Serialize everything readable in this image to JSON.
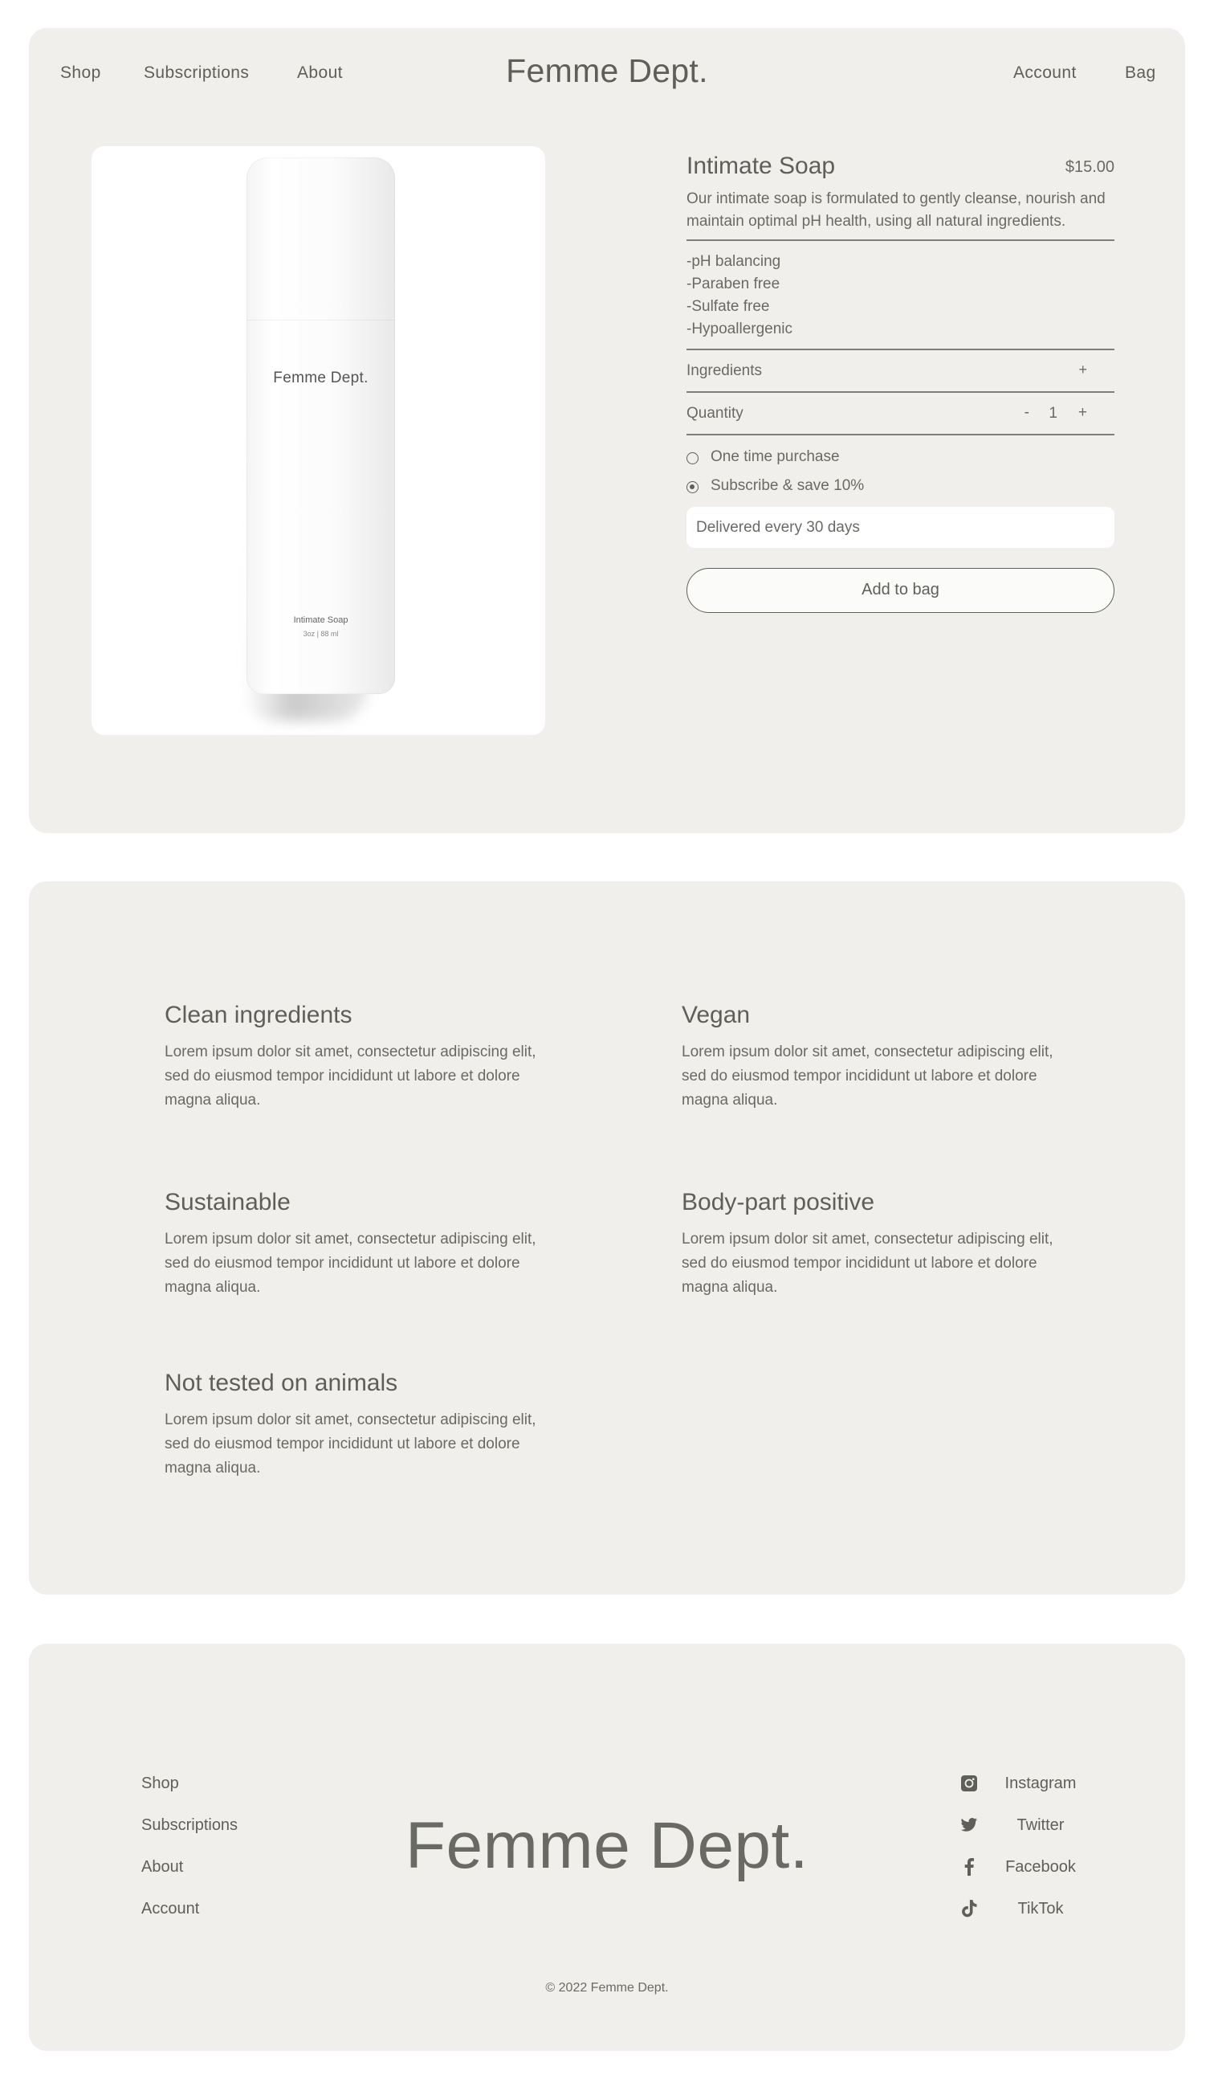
{
  "nav": {
    "shop": "Shop",
    "subscriptions": "Subscriptions",
    "about": "About",
    "brand": "Femme Dept.",
    "account": "Account",
    "bag": "Bag"
  },
  "product_image": {
    "bottle_brand": "Femme Dept.",
    "bottle_name": "Intimate Soap",
    "bottle_size": "3oz | 88 ml"
  },
  "product": {
    "title": "Intimate Soap",
    "price": "$15.00",
    "description": "Our intimate soap is formulated to gently cleanse, nourish and maintain optimal pH health, using all natural ingredients.",
    "bullets": [
      "-pH balancing",
      "-Paraben free",
      "-Sulfate free",
      "-Hypoallergenic"
    ],
    "ingredients_label": "Ingredients",
    "ingredients_toggle": "+",
    "quantity_label": "Quantity",
    "quantity_minus": "-",
    "quantity_value": "1",
    "quantity_plus": "+",
    "purchase_options": [
      {
        "label": "One time purchase",
        "selected": false
      },
      {
        "label": "Subscribe & save 10%",
        "selected": true
      }
    ],
    "delivery_select": "Delivered every 30 days",
    "add_to_bag": "Add to bag"
  },
  "features": [
    {
      "title": "Clean ingredients",
      "text": "Lorem ipsum dolor sit amet, consectetur adipiscing elit, sed do eiusmod tempor incididunt ut labore et dolore magna aliqua."
    },
    {
      "title": "Vegan",
      "text": "Lorem ipsum dolor sit amet, consectetur adipiscing elit, sed do eiusmod tempor incididunt ut labore et dolore magna aliqua."
    },
    {
      "title": "Sustainable",
      "text": "Lorem ipsum dolor sit amet, consectetur adipiscing elit, sed do eiusmod tempor incididunt ut labore et dolore magna aliqua."
    },
    {
      "title": "Body-part positive",
      "text": "Lorem ipsum dolor sit amet, consectetur adipiscing elit, sed do eiusmod tempor incididunt ut labore et dolore magna aliqua."
    },
    {
      "title": "Not tested on animals",
      "text": "Lorem ipsum dolor sit amet, consectetur adipiscing elit, sed do eiusmod tempor incididunt ut labore et dolore magna aliqua."
    }
  ],
  "footer": {
    "links": [
      "Shop",
      "Subscriptions",
      "About",
      "Account"
    ],
    "brand": "Femme Dept.",
    "social": [
      {
        "label": "Instagram",
        "icon": "instagram-icon"
      },
      {
        "label": "Twitter",
        "icon": "twitter-icon"
      },
      {
        "label": "Facebook",
        "icon": "facebook-icon"
      },
      {
        "label": "TikTok",
        "icon": "tiktok-icon"
      }
    ],
    "copyright": "© 2022 Femme Dept."
  },
  "colors": {
    "panel_bg": "#f0efeb",
    "text": "#5f5f5a",
    "page_bg": "#ffffff"
  }
}
